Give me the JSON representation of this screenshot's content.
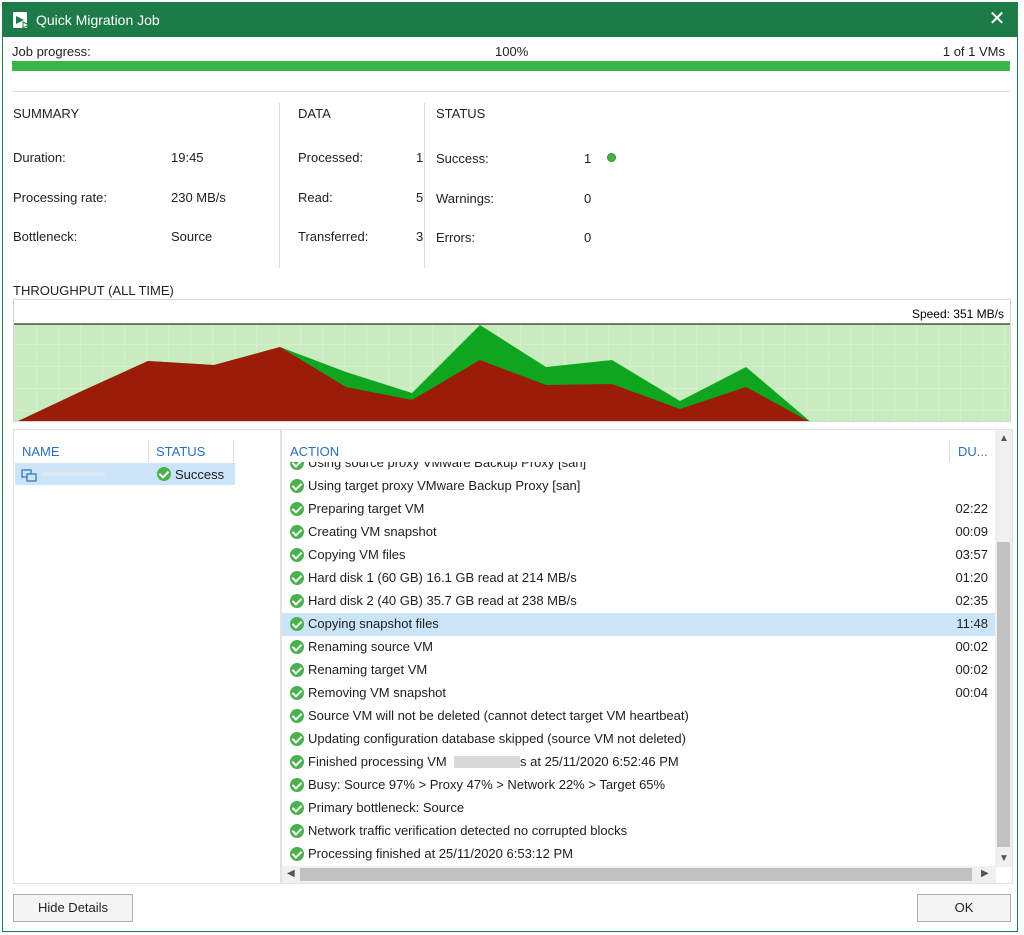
{
  "window": {
    "title": "Quick Migration Job"
  },
  "progress": {
    "label": "Job progress:",
    "percent_text": "100%",
    "percent": 100,
    "vms_text": "1 of 1 VMs"
  },
  "summary": {
    "title": "SUMMARY",
    "duration_label": "Duration:",
    "duration": "19:45",
    "rate_label": "Processing rate:",
    "rate": "230 MB/s",
    "bottleneck_label": "Bottleneck:",
    "bottleneck": "Source"
  },
  "data": {
    "title": "DATA",
    "processed_label": "Processed:",
    "processed": "1",
    "read_label": "Read:",
    "read": "5",
    "transferred_label": "Transferred:",
    "transferred": "3"
  },
  "status": {
    "title": "STATUS",
    "success_label": "Success:",
    "success": "1",
    "warnings_label": "Warnings:",
    "warnings": "0",
    "errors_label": "Errors:",
    "errors": "0"
  },
  "throughput": {
    "title": "THROUGHPUT (ALL TIME)",
    "speed": "Speed: 351 MB/s",
    "colors": {
      "read": "#0fa61f",
      "transfer": "#9b1c08",
      "background": "#c8ecc0"
    }
  },
  "vm_list": {
    "name_header": "NAME",
    "status_header": "STATUS",
    "vm_status": "Success"
  },
  "actions": {
    "action_header": "ACTION",
    "duration_header": "DU...",
    "rows": [
      {
        "text": "Using source proxy VMware Backup Proxy [san]",
        "duration": ""
      },
      {
        "text": "Using target proxy VMware Backup Proxy [san]",
        "duration": ""
      },
      {
        "text": "Preparing target VM",
        "duration": "02:22"
      },
      {
        "text": "Creating VM snapshot",
        "duration": "00:09"
      },
      {
        "text": "Copying VM files",
        "duration": "03:57"
      },
      {
        "text": "Hard disk 1 (60 GB) 16.1 GB read at 214 MB/s",
        "duration": "01:20"
      },
      {
        "text": "Hard disk 2 (40 GB) 35.7 GB read at 238 MB/s",
        "duration": "02:35"
      },
      {
        "text": "Copying snapshot files",
        "duration": "11:48",
        "selected": true
      },
      {
        "text": "Renaming source VM",
        "duration": "00:02"
      },
      {
        "text": "Renaming target VM",
        "duration": "00:02"
      },
      {
        "text": "Removing VM snapshot",
        "duration": "00:04"
      },
      {
        "text": "Source VM will not be deleted (cannot detect target VM heartbeat)",
        "duration": ""
      },
      {
        "text": "Updating configuration database skipped (source VM not deleted)",
        "duration": ""
      },
      {
        "text": "Finished processing VM",
        "suffix": "s at 25/11/2020 6:52:46 PM",
        "redacted": true,
        "duration": ""
      },
      {
        "text": "Busy: Source 97% > Proxy 47% > Network 22% > Target 65%",
        "duration": ""
      },
      {
        "text": "Primary bottleneck: Source",
        "duration": ""
      },
      {
        "text": "Network traffic verification detected no corrupted blocks",
        "duration": ""
      },
      {
        "text": "Processing finished at 25/11/2020 6:53:12 PM",
        "duration": ""
      }
    ]
  },
  "buttons": {
    "hide_details": "Hide Details",
    "ok": "OK"
  }
}
